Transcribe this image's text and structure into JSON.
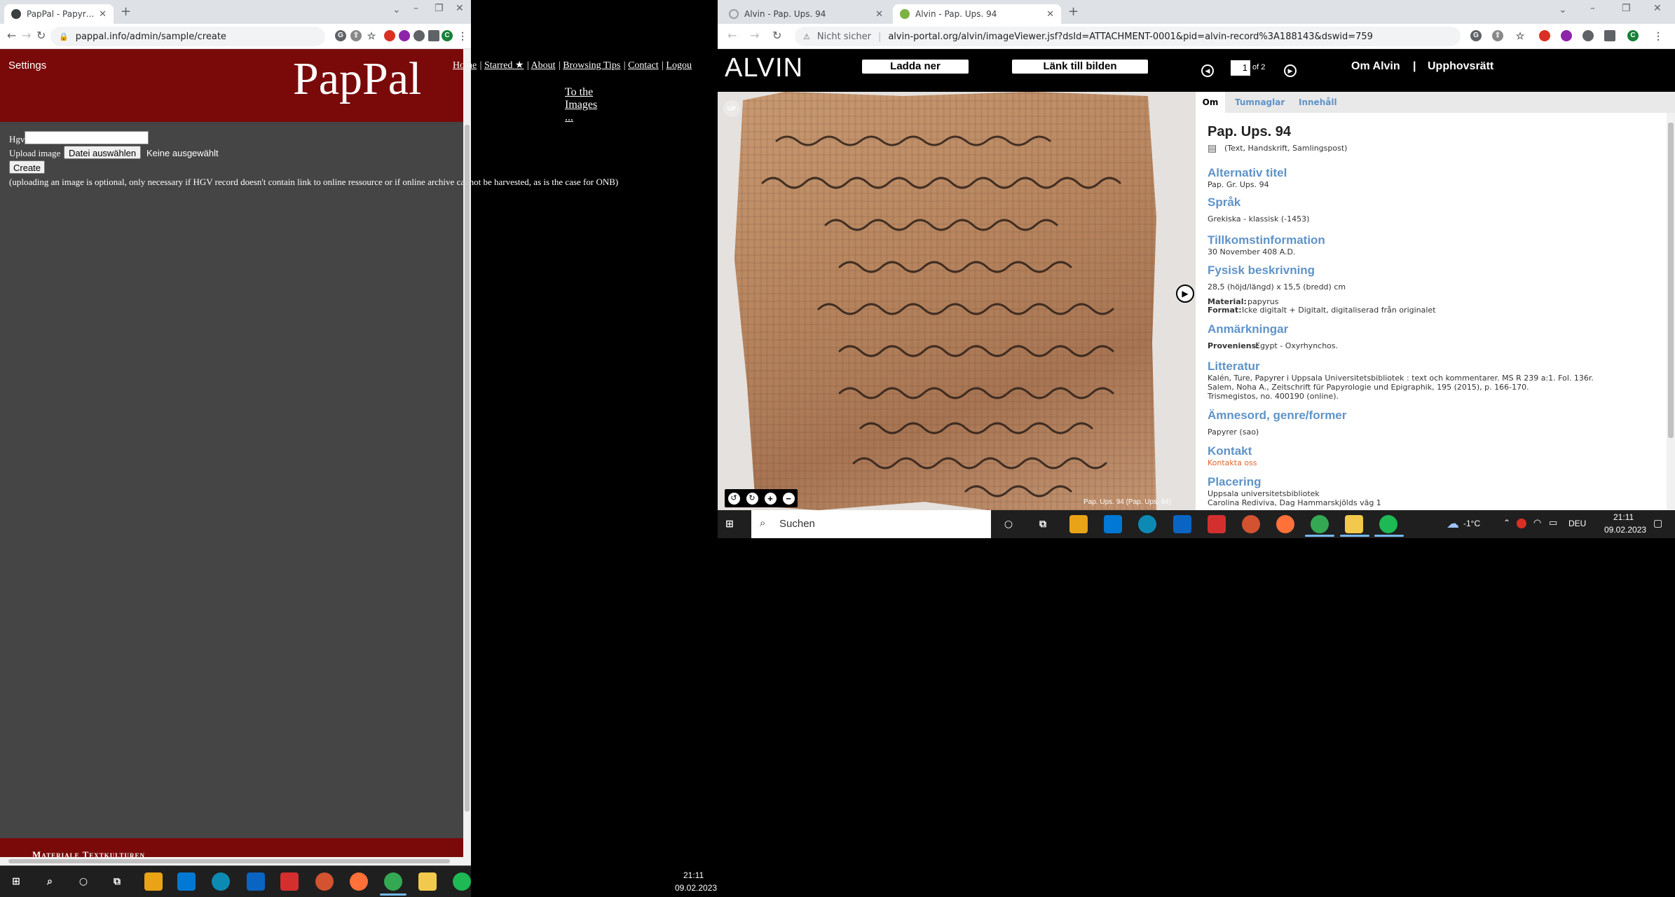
{
  "left_browser": {
    "tab_title": "PapPal - Papyrology | Paleograph",
    "url": "pappal.info/admin/sample/create"
  },
  "pappal": {
    "settings": "Settings",
    "logo": "PapPal",
    "nav": [
      "Home",
      "Starred ★",
      "About",
      "Browsing Tips",
      "Contact",
      "Logou"
    ],
    "to_images": "To the Images ...",
    "hgv_label": "Hgv",
    "upload_label": "Upload image",
    "file_button": "Datei auswählen",
    "file_status": "Keine ausgewählt",
    "create_button": "Create",
    "note": "(uploading an image is optional, only necessary if HGV record doesn't contain link to online ressource or if online archive cannot be harvested, as is the case for ONB)",
    "footer_text": "Materiale Textkulturen"
  },
  "left_taskbar": {
    "time": "21:11",
    "date": "09.02.2023"
  },
  "right_browser": {
    "tab1_title": "Alvin - Pap. Ups. 94",
    "tab2_title": "Alvin - Pap. Ups. 94",
    "security": "Nicht sicher",
    "url": "alvin-portal.org/alvin/imageViewer.jsf?dsId=ATTACHMENT-0001&pid=alvin-record%3A188143&dswid=759"
  },
  "alvin": {
    "logo": "ALVIN",
    "download": "Ladda ner",
    "link_image": "Länk till bilden",
    "page_current": "1",
    "page_of": "of 2",
    "about": "Om Alvin",
    "separator": "|",
    "copyright": "Upphovsrätt",
    "image_caption": "Pap. Ups. 94 (Pap. Ups. 94)",
    "watermark": "UP",
    "tabs": [
      "Om",
      "Tumnaglar",
      "Innehåll"
    ],
    "record_title": "Pap. Ups. 94",
    "record_type": "(Text, Handskrift, Samlingspost)",
    "sections": {
      "alt_title_h": "Alternativ titel",
      "alt_title_v": "Pap. Gr. Ups. 94",
      "lang_h": "Språk",
      "lang_v": "Grekiska - klassisk (-1453)",
      "origin_h": "Tillkomstinformation",
      "origin_v": "30 November 408 A.D.",
      "phys_h": "Fysisk beskrivning",
      "phys_v": "28,5 (höjd/längd) x 15,5 (bredd) cm",
      "material_label": "Material:",
      "material_v": "papyrus",
      "format_label": "Format:",
      "format_v": "Icke digitalt + Digitalt, digitaliserad från originalet",
      "notes_h": "Anmärkningar",
      "prov_label": "Proveniens:",
      "prov_v": "Egypt - Oxyrhynchos.",
      "lit_h": "Litteratur",
      "lit_1": "Kalén, Ture, Papyrer i Uppsala Universitetsbibliotek : text och kommentarer. MS R 239 a:1. Fol. 136r.",
      "lit_2": "Salem, Noha A., Zeitschrift für Papyrologie und Epigraphik, 195 (2015), p. 166-170.",
      "lit_3": "Trismegistos, no. 400190 (online).",
      "subj_h": "Ämnesord, genre/former",
      "subj_v": "Papyrer (sao)",
      "contact_h": "Kontakt",
      "contact_v": "Kontakta oss",
      "place_h": "Placering",
      "place_1": "Uppsala universitetsbibliotek",
      "place_2": "Carolina Rediviva, Dag Hammarskjölds väg 1"
    }
  },
  "right_taskbar": {
    "search_placeholder": "Suchen",
    "weather": "-1°C",
    "lang": "DEU",
    "time": "21:11",
    "date": "09.02.2023"
  },
  "colors": {
    "pappal_red": "#7a0a0a",
    "pappal_body": "#454545",
    "alvin_blue": "#5f93c8",
    "contact_orange": "#e0642e"
  }
}
